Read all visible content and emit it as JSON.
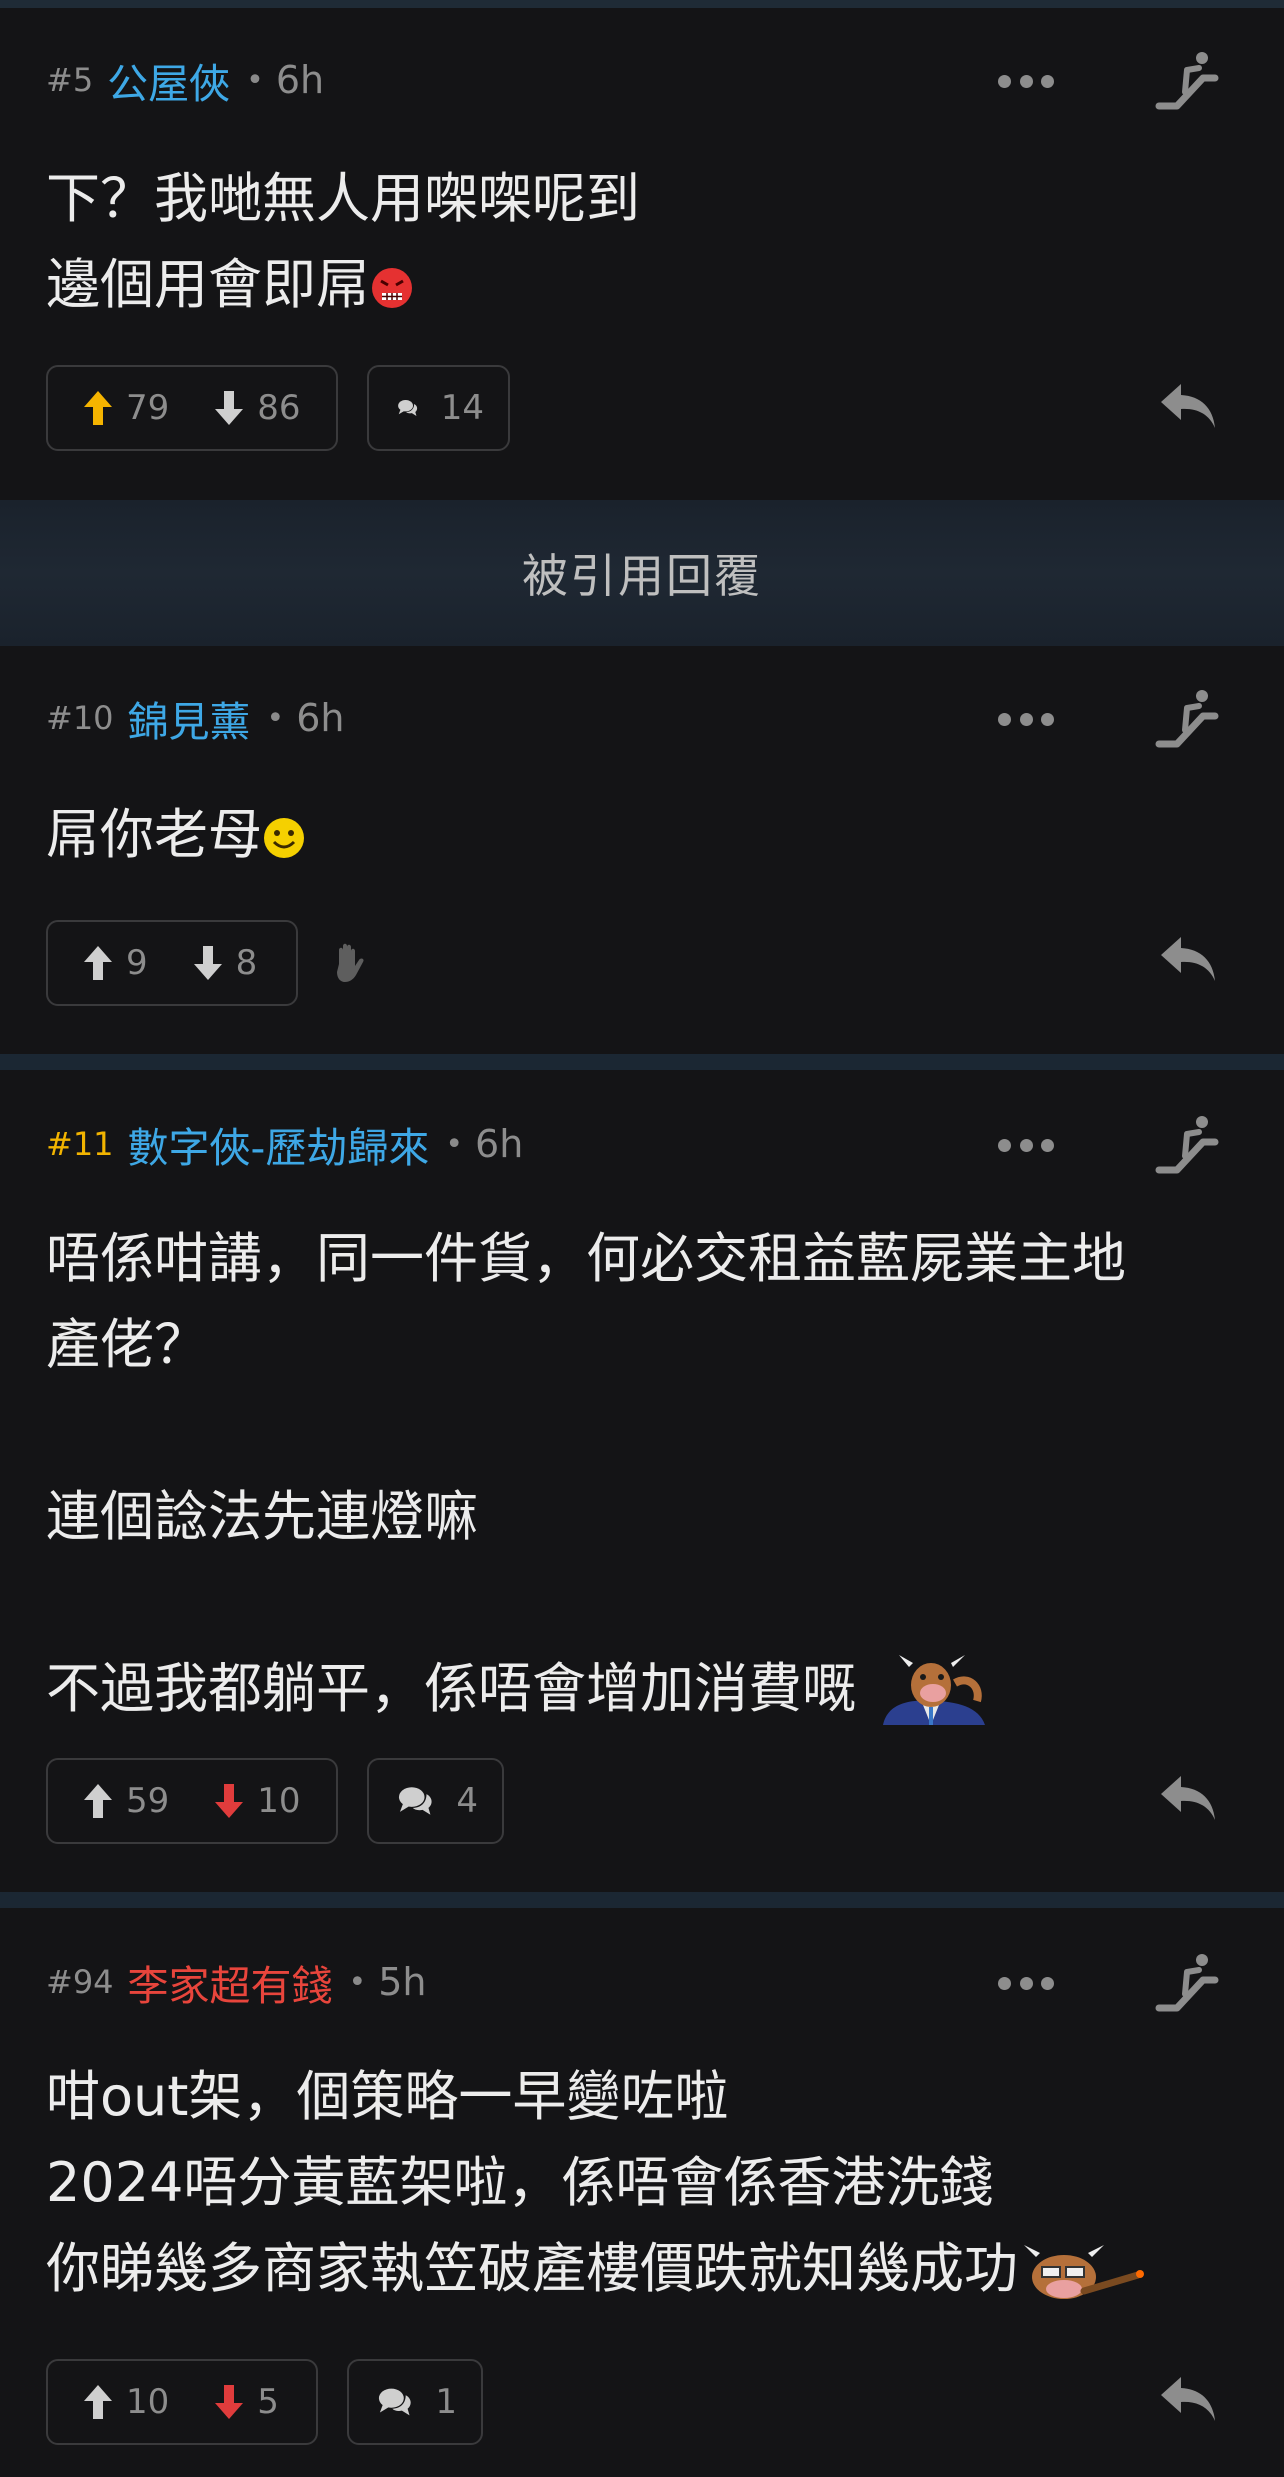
{
  "quoted_bar_label": "被引用回覆",
  "posts": [
    {
      "floor": "#5",
      "username": "公屋俠",
      "time": "6h",
      "lines": [
        "下？我哋無人用㗎㗎呢到",
        "邊個用會即屌"
      ],
      "upvotes": "79",
      "downvotes": "86",
      "comments": "14"
    },
    {
      "floor": "#10",
      "username": "錦見薰",
      "time": "6h",
      "lines": [
        "屌你老母"
      ],
      "upvotes": "9",
      "downvotes": "8"
    },
    {
      "floor": "#11",
      "username": "數字俠-歷劫歸來",
      "time": "6h",
      "lines": [
        "唔係咁講，同一件貨，何必交租益藍屍業主地",
        "產佬？",
        "",
        "連個諗法先連燈嘛",
        "",
        "不過我都躺平，係唔會增加消費嘅"
      ],
      "upvotes": "59",
      "downvotes": "10",
      "comments": "4"
    },
    {
      "floor": "#94",
      "username": "李家超有錢",
      "time": "5h",
      "lines": [
        "咁out架，個策略一早變咗啦",
        "2024唔分黃藍架啦，係唔會係香港洗錢",
        "你睇幾多商家執笠破產樓價跌就知幾成功"
      ],
      "upvotes": "10",
      "downvotes": "5",
      "comments": "1"
    }
  ],
  "colors": {
    "background": "#141416",
    "username_blue": "#3ea8e6",
    "username_red": "#e8453c",
    "author_floor": "#f2b400",
    "upvote_active": "#f5b400",
    "downvote_active": "#e03c3c",
    "muted": "#8d8d8d"
  },
  "icons": [
    "more-icon",
    "escalator-icon",
    "upvote-icon",
    "downvote-icon",
    "comment-icon",
    "reply-icon",
    "hand-icon"
  ]
}
